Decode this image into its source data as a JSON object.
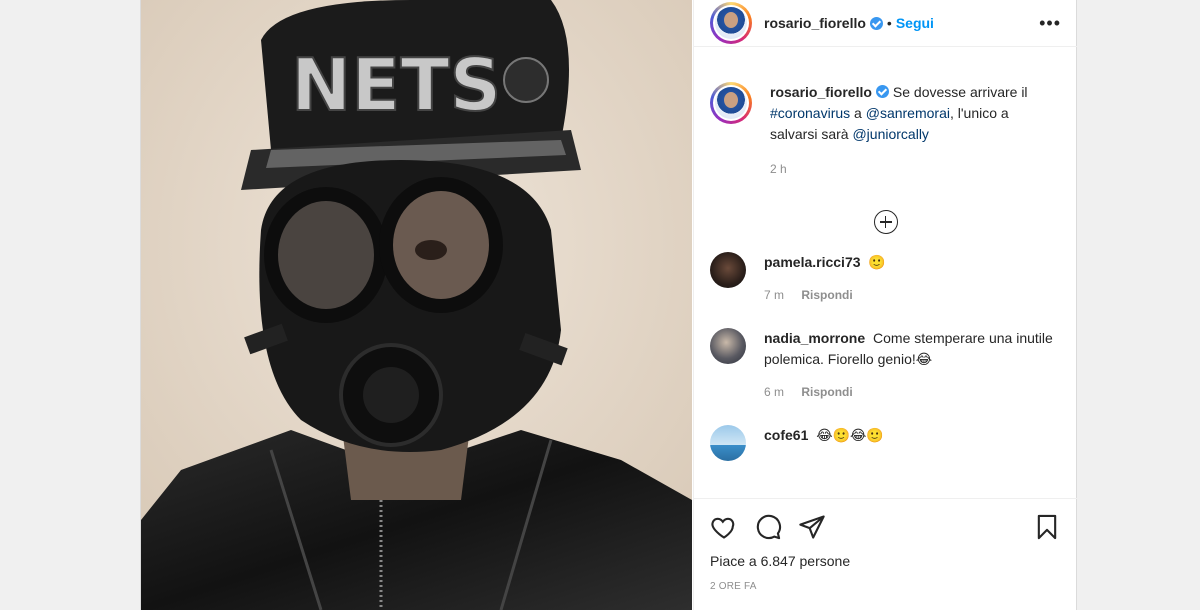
{
  "post": {
    "author": {
      "username": "rosario_fiorello",
      "verified": true,
      "follow_label": "Segui",
      "separator": "•",
      "more_label": "•••"
    },
    "caption": {
      "username": "rosario_fiorello",
      "text_parts": [
        "Se dovesse arrivare il ",
        "#coronavirus",
        " a ",
        "@sanremorai",
        ", l'unico a salvarsi sarà ",
        "@juniorcally"
      ],
      "time": "2 h"
    },
    "comments": [
      {
        "username": "pamela.ricci73",
        "text": "🙂",
        "time": "7 m",
        "reply_label": "Rispondi"
      },
      {
        "username": "nadia_morrone",
        "text": "Come stemperare una inutile polemica. Fiorello genio!😂",
        "time": "6 m",
        "reply_label": "Rispondi"
      },
      {
        "username": "cofe61",
        "text": "😂🙂😂🙂"
      }
    ],
    "likes_text": "Piace a 6.847 persone",
    "timestamp": "2 ORE FA"
  },
  "icons": {
    "like": "heart-icon",
    "comment": "comment-icon",
    "share": "paper-plane-icon",
    "save": "bookmark-icon",
    "load_more": "plus-circle-icon"
  },
  "colors": {
    "link": "#00376b",
    "follow": "#0095f6",
    "verified": "#3897f0",
    "muted": "#8e8e8e"
  }
}
